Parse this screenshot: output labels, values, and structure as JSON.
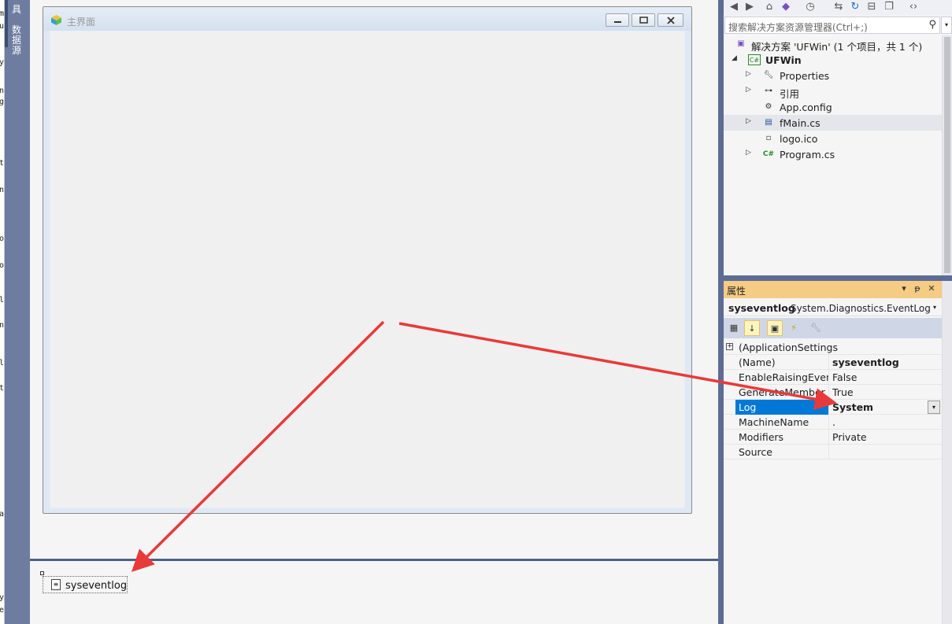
{
  "left_strip": {
    "chars": [
      "m",
      "u",
      "y",
      "n",
      "g",
      "t",
      "n",
      "o",
      "o",
      "l",
      "n",
      "l",
      "t",
      "a",
      "y",
      "el"
    ]
  },
  "side_tab": {
    "label": "数据源",
    "top_label": "具"
  },
  "form": {
    "title": "主界面"
  },
  "tray": {
    "component_label": "syseventlog"
  },
  "solution_explorer": {
    "toolbar_icons": [
      "back-icon",
      "forward-icon",
      "home-icon",
      "vs-icon",
      "sync-icon",
      "history-icon",
      "swap-icon",
      "refresh-icon",
      "collapse-icon",
      "copy-icon",
      "code-icon"
    ],
    "search_placeholder": "搜索解决方案资源管理器(Ctrl+;)",
    "tree": [
      {
        "label": "解决方案 'UFWin' (1 个项目，共 1 个)",
        "icon": "solution-icon",
        "expander": ""
      },
      {
        "label": "UFWin",
        "icon": "csharp-project-icon",
        "expander": "◢"
      },
      {
        "label": "Properties",
        "icon": "wrench-icon",
        "expander": "▷"
      },
      {
        "label": "引用",
        "icon": "references-icon",
        "expander": "▷"
      },
      {
        "label": "App.config",
        "icon": "config-file-icon",
        "expander": ""
      },
      {
        "label": "fMain.cs",
        "icon": "form-file-icon",
        "expander": "▷"
      },
      {
        "label": "logo.ico",
        "icon": "icon-file-icon",
        "expander": ""
      },
      {
        "label": "Program.cs",
        "icon": "csharp-file-icon",
        "expander": "▷"
      }
    ]
  },
  "properties": {
    "title": "属性",
    "object_name": "syseventlog",
    "object_type": "System.Diagnostics.EventLog",
    "rows": [
      {
        "name": "(ApplicationSettings",
        "value": ""
      },
      {
        "name": "(Name)",
        "value": "syseventlog"
      },
      {
        "name": "EnableRaisingEvents",
        "value": "False"
      },
      {
        "name": "GenerateMember",
        "value": "True"
      },
      {
        "name": "Log",
        "value": "System"
      },
      {
        "name": "MachineName",
        "value": "."
      },
      {
        "name": "Modifiers",
        "value": "Private"
      },
      {
        "name": "Source",
        "value": ""
      }
    ]
  },
  "colors": {
    "accent_header": "#f5cc84",
    "selection": "#0078d7",
    "annotation_arrow": "#e83a3a",
    "dock_frame": "#5d6b95"
  }
}
